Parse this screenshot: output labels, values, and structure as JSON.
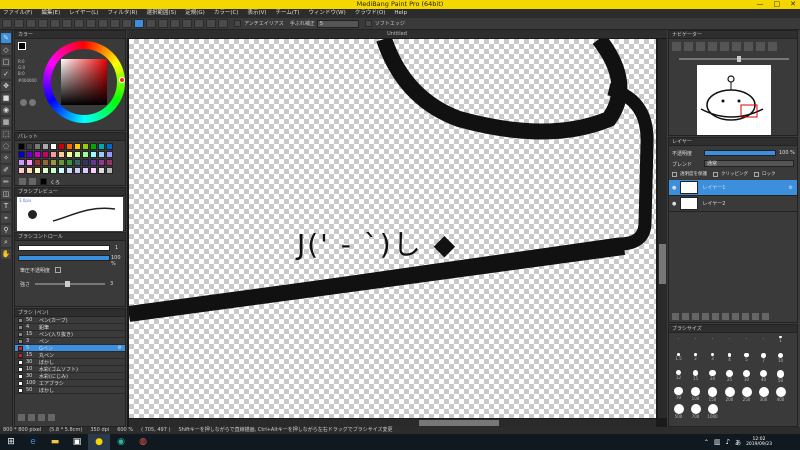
{
  "app": {
    "title": "MediBang Paint Pro (64bit)",
    "win_controls": [
      "—",
      "□",
      "✕"
    ]
  },
  "menu": [
    "ファイル(F)",
    "編集(E)",
    "レイヤー(L)",
    "フィルタ(R)",
    "選択範囲(S)",
    "定規(G)",
    "カラー(C)",
    "表示(V)",
    "チーム(T)",
    "ウィンドウ(W)",
    "クラウド(O)",
    "Help"
  ],
  "toolbar": {
    "antialias_label": "アンチエイリアス",
    "correction_label": "手ぶれ補正",
    "correction_value": "5",
    "softedge_label": "ソフトエッジ"
  },
  "document": {
    "tab_title": "Untitled",
    "handwriting": "J(' - `)し ◆"
  },
  "color_panel": {
    "title": "カラー",
    "rgb": [
      "R:0",
      "G:0",
      "B:0"
    ],
    "hex": "#000000"
  },
  "palette_panel": {
    "title": "パレット",
    "label": "くろ"
  },
  "brush_preview_panel": {
    "title": "ブラシプレビュー",
    "size": "3.0pix"
  },
  "brush_control_panel": {
    "title": "ブラシコントロール",
    "size_val": "1",
    "opacity_val": "100 %",
    "pressure_label": "筆圧不透明度",
    "strength_label": "強さ",
    "strength_val": "3"
  },
  "brush_list_panel": {
    "title": "ブラシ (ペン)",
    "items": [
      {
        "size": "50",
        "name": "ペン(カーブ)",
        "color": "#888888",
        "active": false
      },
      {
        "size": "4",
        "name": "鉛筆",
        "color": "#888888",
        "active": false
      },
      {
        "size": "15",
        "name": "ペン(入り抜き)",
        "color": "#888888",
        "active": false
      },
      {
        "size": "3",
        "name": "ペン",
        "color": "#888888",
        "active": false
      },
      {
        "size": "5",
        "name": "Gペン",
        "color": "#cc2222",
        "active": true
      },
      {
        "size": "15",
        "name": "丸ペン",
        "color": "#cc2222",
        "active": false
      },
      {
        "size": "30",
        "name": "ぼかし",
        "color": "#ffffff",
        "active": false
      },
      {
        "size": "10",
        "name": "水彩(ゴムソフト)",
        "color": "#ffffff",
        "active": false
      },
      {
        "size": "30",
        "name": "水彩(にじみ)",
        "color": "#ffffff",
        "active": false
      },
      {
        "size": "100",
        "name": "エアブラシ",
        "color": "#ffffff",
        "active": false
      },
      {
        "size": "50",
        "name": "ぼかし",
        "color": "#ffffff",
        "active": false
      }
    ]
  },
  "navigator_panel": {
    "title": "ナビゲーター"
  },
  "layer_panel": {
    "title": "レイヤー",
    "opacity_label": "不透明度",
    "opacity_val": "100 %",
    "blend_label": "ブレンド",
    "blend_val": "通常",
    "protect_label": "透明度を保護",
    "clipping_label": "クリッピング",
    "lock_label": "ロック",
    "layers": [
      {
        "name": "レイヤー1",
        "active": true
      },
      {
        "name": "レイヤー2",
        "active": false
      }
    ]
  },
  "brushsize_panel": {
    "title": "ブラシサイズ",
    "sizes": [
      "-",
      "-",
      "-",
      "-",
      "-",
      "-",
      "1",
      "1.5",
      "2",
      "3",
      "4",
      "5",
      "7",
      "10",
      "12",
      "15",
      "20",
      "25",
      "30",
      "40",
      "50",
      "70",
      "100",
      "150",
      "200",
      "250",
      "300",
      "400",
      "500",
      "700",
      "1000"
    ]
  },
  "status": {
    "dims": "800 * 800 pixel",
    "physical": "(5.8 * 5.8cm)",
    "dpi": "350 dpi",
    "zoom": "600 %",
    "coords": "( 705, 497 )",
    "hint": "Shiftキーを押しながらで直線描画, Ctrl+Altキーを押しながら左右ドラッグでブラシサイズ変更"
  },
  "taskbar": {
    "time": "12:02",
    "date": "2019/09/23"
  }
}
